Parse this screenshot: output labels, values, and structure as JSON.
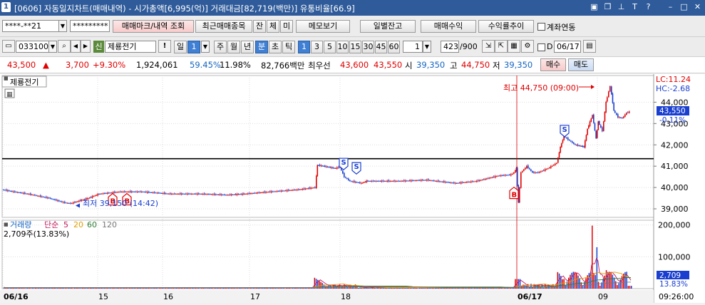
{
  "window": {
    "number": "1",
    "title": "[0606] 자동일지차트(매매내역) - 시가총액[6,995(억)] 거래대금[82,719(백만)] 유통비율[66.9]",
    "title_icons": [
      "window-layout-icon",
      "copy-icon",
      "pin-icon",
      "font-size-icon",
      "help-icon",
      "minimize-icon",
      "maximize-icon",
      "close-icon"
    ]
  },
  "toolbar1": {
    "account": "****-**21",
    "password": "*********",
    "trade_mark_button": "매매마크/내역 조회",
    "recent_trades_button": "최근매매종목",
    "balance_button": "잔",
    "execution_button": "체",
    "unfilled_button": "미",
    "memo_button": "메모보기",
    "daily_balance_button": "일별잔고",
    "trade_profit_button": "매매수익",
    "return_trend_button": "수익률추이",
    "account_link_label": "계좌연동"
  },
  "toolbar2": {
    "stock_code": "033100",
    "credit_badge": "신",
    "stock_name": "제룡전기",
    "period_buttons": [
      "일",
      "1",
      "주",
      "월",
      "년",
      "분",
      "초",
      "틱"
    ],
    "interval_buttons": [
      "1",
      "3",
      "5",
      "10",
      "15",
      "30",
      "45",
      "60"
    ],
    "interval_value": "1",
    "count_value": "423",
    "count_total": "/900",
    "d_label": "D",
    "date_value": "06/17"
  },
  "price_bar": {
    "current_price": "43,500",
    "change_arrow": "▲",
    "change": "3,700",
    "change_pct": "+9.30%",
    "volume": "1,924,061",
    "volume_ratio": "59.45%",
    "turnover": "11.98%",
    "amount": "82,766백만",
    "best_ask_label": "최우선",
    "best_ask": "43,600",
    "best_bid": "43,550",
    "open_label": "시",
    "open": "39,350",
    "high_label": "고",
    "high": "44,750",
    "low_label": "저",
    "low": "39,350",
    "buy_button": "매수",
    "sell_button": "매도"
  },
  "chart_data": {
    "type": "line",
    "title": "제룡전기",
    "high_annotation": "최고 44,750 (09:00)",
    "low_annotation": "최저 39,150 (14:42)",
    "lc_label": "LC:11.24",
    "hc_label": "HC:-2.68",
    "price_tag": "43,550",
    "price_tag_pct": "-0.11%",
    "reference_line": 41350,
    "price_axis_ticks": [
      "44,000",
      "43,000",
      "42,000",
      "41,000",
      "40,000",
      "39,000"
    ],
    "price_axis_values": [
      44000,
      43000,
      42000,
      41000,
      40000,
      39000
    ],
    "price_ylim": [
      38600,
      45250
    ],
    "x_labels": [
      "06/16",
      "15",
      "16",
      "17",
      "18",
      "06/17",
      "09"
    ],
    "time_label": "09:26:00",
    "price_series_tail": [
      43500,
      43600,
      43550
    ],
    "trade_marks": [
      {
        "label": "B",
        "type": "buy"
      },
      {
        "label": "B",
        "type": "buy"
      },
      {
        "label": "S",
        "type": "sell"
      },
      {
        "label": "S",
        "type": "sell"
      },
      {
        "label": "B",
        "type": "buy"
      },
      {
        "label": "S",
        "type": "sell"
      }
    ],
    "volume_panel": {
      "title": "거래량",
      "ma_label": "단순",
      "ma_periods": [
        "5",
        "20",
        "60",
        "120"
      ],
      "current_volume": "2,709주(13.83%)",
      "axis_ticks": [
        "200,000",
        "100,000"
      ],
      "axis_values": [
        200000,
        100000
      ],
      "tag": "2,709",
      "tag_pct": "13.83%"
    },
    "colors": {
      "up": "#e00000",
      "down": "#1a3fd0",
      "ma5": "#c2185b",
      "ma20": "#e0a000",
      "ma60": "#2e7d32",
      "ma120": "#777777"
    }
  }
}
